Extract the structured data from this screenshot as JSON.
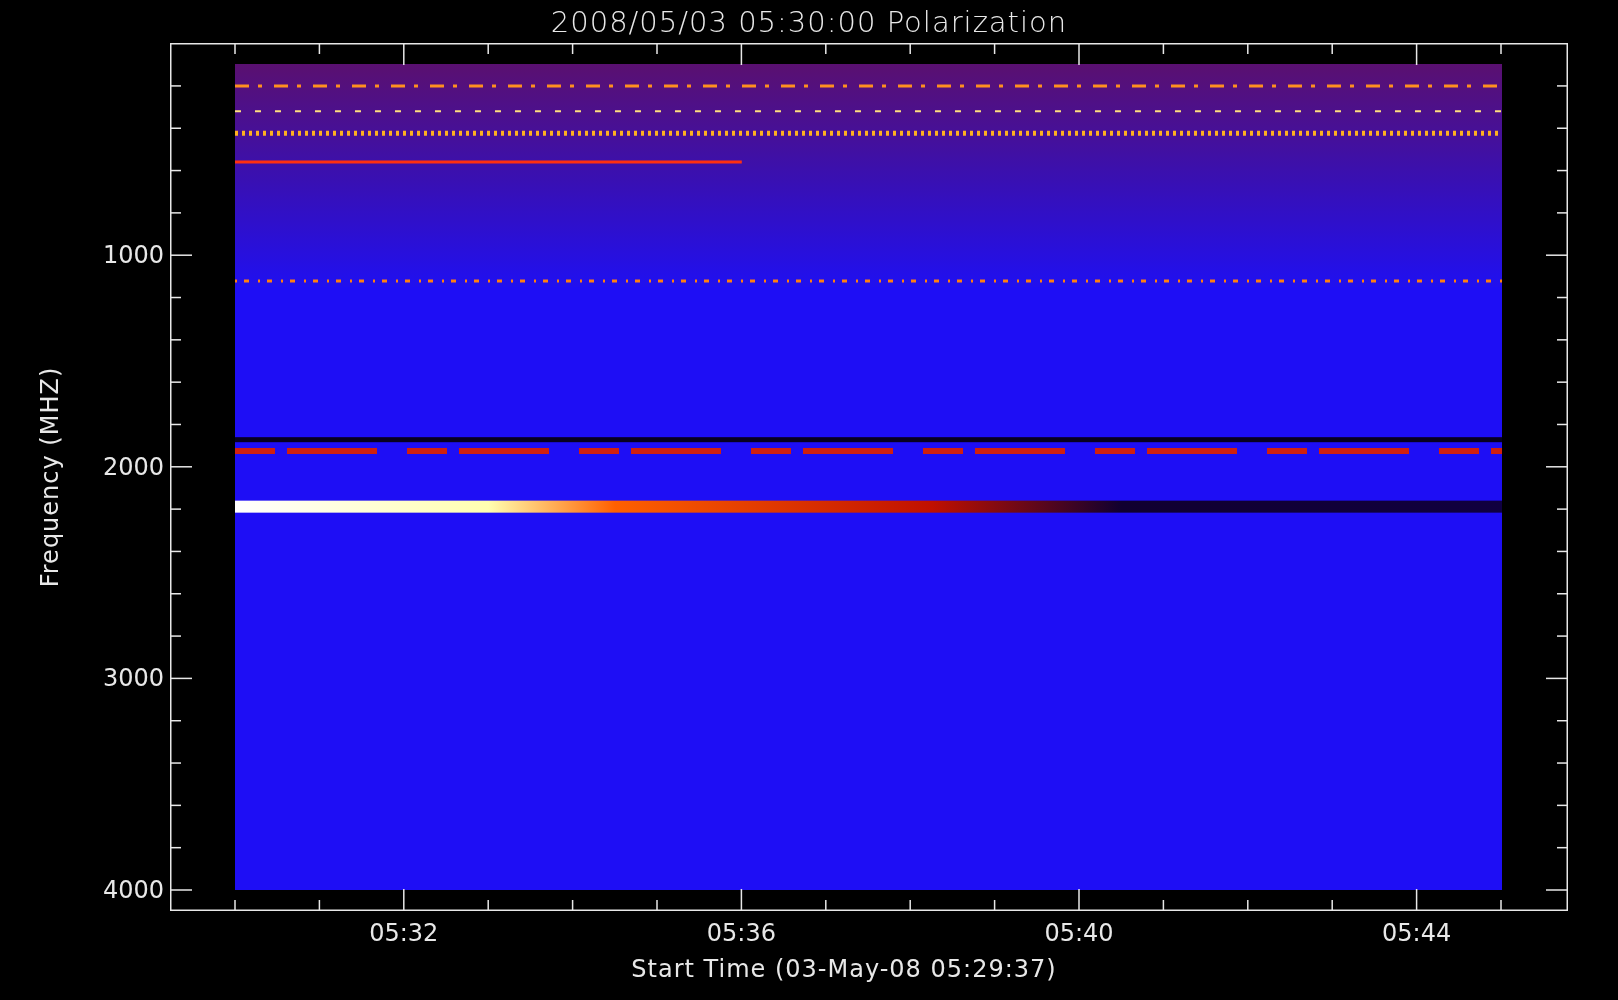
{
  "title": "2008/05/03 05:30:00 Polarization",
  "y_axis": {
    "label": "Frequency (MHZ)",
    "ticks": [
      "1000",
      "2000",
      "3000",
      "4000"
    ]
  },
  "x_axis": {
    "label": "Start Time (03-May-08 05:29:37)",
    "ticks": [
      "05:32",
      "05:36",
      "05:40",
      "05:44"
    ]
  }
}
